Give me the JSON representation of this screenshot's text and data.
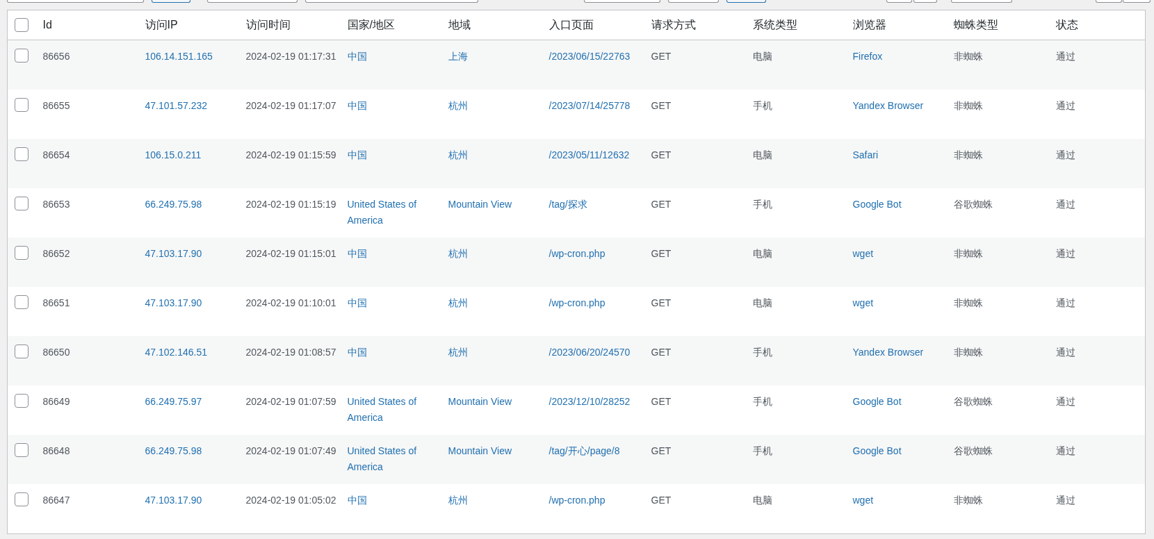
{
  "table": {
    "select_all": {
      "checked": false
    },
    "columns": [
      {
        "label": "Id",
        "kind": "text"
      },
      {
        "label": "访问IP",
        "kind": "link"
      },
      {
        "label": "访问时间",
        "kind": "text"
      },
      {
        "label": "国家/地区",
        "kind": "link"
      },
      {
        "label": "地域",
        "kind": "link"
      },
      {
        "label": "入口页面",
        "kind": "link"
      },
      {
        "label": "请求方式",
        "kind": "text"
      },
      {
        "label": "系统类型",
        "kind": "text"
      },
      {
        "label": "浏览器",
        "kind": "link"
      },
      {
        "label": "蜘蛛类型",
        "kind": "text"
      },
      {
        "label": "状态",
        "kind": "text"
      }
    ],
    "rows": [
      {
        "checked": false,
        "cells": [
          "86656",
          "106.14.151.165",
          "2024-02-19 01:17:31",
          "中国",
          "上海",
          "/2023/06/15/22763",
          "GET",
          "电脑",
          "Firefox",
          "非蜘蛛",
          "通过"
        ]
      },
      {
        "checked": false,
        "cells": [
          "86655",
          "47.101.57.232",
          "2024-02-19 01:17:07",
          "中国",
          "杭州",
          "/2023/07/14/25778",
          "GET",
          "手机",
          "Yandex Browser",
          "非蜘蛛",
          "通过"
        ]
      },
      {
        "checked": false,
        "cells": [
          "86654",
          "106.15.0.211",
          "2024-02-19 01:15:59",
          "中国",
          "杭州",
          "/2023/05/11/12632",
          "GET",
          "电脑",
          "Safari",
          "非蜘蛛",
          "通过"
        ]
      },
      {
        "checked": false,
        "cells": [
          "86653",
          "66.249.75.98",
          "2024-02-19 01:15:19",
          "United States of America",
          "Mountain View",
          "/tag/探求",
          "GET",
          "手机",
          "Google Bot",
          "谷歌蜘蛛",
          "通过"
        ]
      },
      {
        "checked": false,
        "cells": [
          "86652",
          "47.103.17.90",
          "2024-02-19 01:15:01",
          "中国",
          "杭州",
          "/wp-cron.php",
          "GET",
          "电脑",
          "wget",
          "非蜘蛛",
          "通过"
        ]
      },
      {
        "checked": false,
        "cells": [
          "86651",
          "47.103.17.90",
          "2024-02-19 01:10:01",
          "中国",
          "杭州",
          "/wp-cron.php",
          "GET",
          "电脑",
          "wget",
          "非蜘蛛",
          "通过"
        ]
      },
      {
        "checked": false,
        "cells": [
          "86650",
          "47.102.146.51",
          "2024-02-19 01:08:57",
          "中国",
          "杭州",
          "/2023/06/20/24570",
          "GET",
          "手机",
          "Yandex Browser",
          "非蜘蛛",
          "通过"
        ]
      },
      {
        "checked": false,
        "cells": [
          "86649",
          "66.249.75.97",
          "2024-02-19 01:07:59",
          "United States of America",
          "Mountain View",
          "/2023/12/10/28252",
          "GET",
          "手机",
          "Google Bot",
          "谷歌蜘蛛",
          "通过"
        ]
      },
      {
        "checked": false,
        "cells": [
          "86648",
          "66.249.75.98",
          "2024-02-19 01:07:49",
          "United States of America",
          "Mountain View",
          "/tag/开心/page/8",
          "GET",
          "手机",
          "Google Bot",
          "谷歌蜘蛛",
          "通过"
        ]
      },
      {
        "checked": false,
        "cells": [
          "86647",
          "47.103.17.90",
          "2024-02-19 01:05:02",
          "中国",
          "杭州",
          "/wp-cron.php",
          "GET",
          "电脑",
          "wget",
          "非蜘蛛",
          "通过"
        ]
      }
    ]
  }
}
